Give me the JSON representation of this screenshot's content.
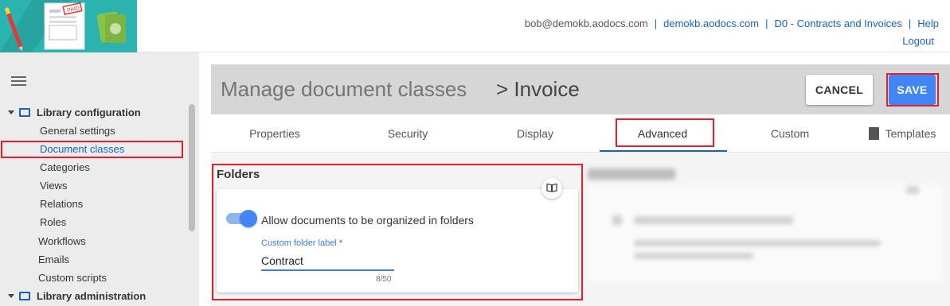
{
  "topbar": {
    "user_email": "bob@demokb.aodocs.com",
    "domain_link": "demokb.aodocs.com",
    "library_link": "D0 - Contracts and Invoices",
    "help_link": "Help",
    "logout_link": "Logout",
    "logo_badge": "PAID"
  },
  "sidebar": {
    "groups": [
      {
        "label": "Library configuration",
        "items": [
          "General settings",
          "Document classes",
          "Categories",
          "Views",
          "Relations",
          "Roles"
        ]
      }
    ],
    "extra_items": [
      "Workflows",
      "Emails",
      "Custom scripts"
    ],
    "second_group": "Library administration",
    "active_item": "Document classes"
  },
  "header": {
    "crumb_root": "Manage document classes",
    "crumb_current": "> Invoice",
    "cancel_label": "CANCEL",
    "save_label": "SAVE"
  },
  "tabs": {
    "items": [
      "Properties",
      "Security",
      "Display",
      "Advanced",
      "Custom",
      "Templates"
    ],
    "selected": "Advanced"
  },
  "folders": {
    "title": "Folders",
    "toggle_label": "Allow documents to be organized in folders",
    "toggle_on": true,
    "field_label": "Custom folder label",
    "field_required_mark": "*",
    "field_value": "Contract",
    "counter": "8/50"
  },
  "colors": {
    "accent": "#4285f4",
    "link": "#1565c0",
    "highlight": "#e41e2c",
    "logo_bg": "#2bb3b0"
  }
}
